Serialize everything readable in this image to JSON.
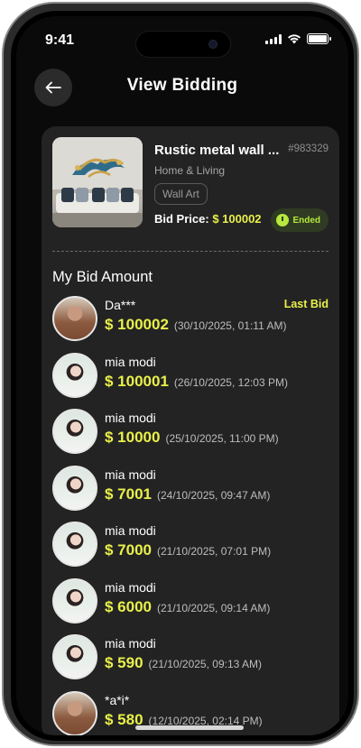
{
  "status_bar": {
    "time": "9:41"
  },
  "header": {
    "title": "View Bidding"
  },
  "product": {
    "name": "Rustic metal wall ...",
    "id": "#983329",
    "category": "Home & Living",
    "tag": "Wall Art",
    "bid_price_label": "Bid Price:",
    "bid_price_value": "$ 100002",
    "status": "Ended"
  },
  "bids_section": {
    "title": "My Bid Amount",
    "last_bid_label": "Last Bid",
    "bids": [
      {
        "name": "Da***",
        "amount": "$ 100002",
        "date": "(30/10/2025, 01:11 AM)",
        "avatar": "male"
      },
      {
        "name": "mia modi",
        "amount": "$ 100001",
        "date": "(26/10/2025, 12:03 PM)",
        "avatar": "female"
      },
      {
        "name": "mia modi",
        "amount": "$ 10000",
        "date": "(25/10/2025, 11:00 PM)",
        "avatar": "female"
      },
      {
        "name": "mia modi",
        "amount": "$ 7001",
        "date": "(24/10/2025, 09:47 AM)",
        "avatar": "female"
      },
      {
        "name": "mia modi",
        "amount": "$ 7000",
        "date": "(21/10/2025, 07:01 PM)",
        "avatar": "female"
      },
      {
        "name": "mia modi",
        "amount": "$ 6000",
        "date": "(21/10/2025, 09:14 AM)",
        "avatar": "female"
      },
      {
        "name": "mia modi",
        "amount": "$ 590",
        "date": "(21/10/2025, 09:13 AM)",
        "avatar": "female"
      },
      {
        "name": "*a*i*",
        "amount": "$ 580",
        "date": "(12/10/2025, 02:14 PM)",
        "avatar": "male"
      }
    ]
  },
  "colors": {
    "accent": "#e9f04a",
    "ended": "#b6e83e",
    "card": "#232323",
    "background": "#0a0a0a"
  }
}
